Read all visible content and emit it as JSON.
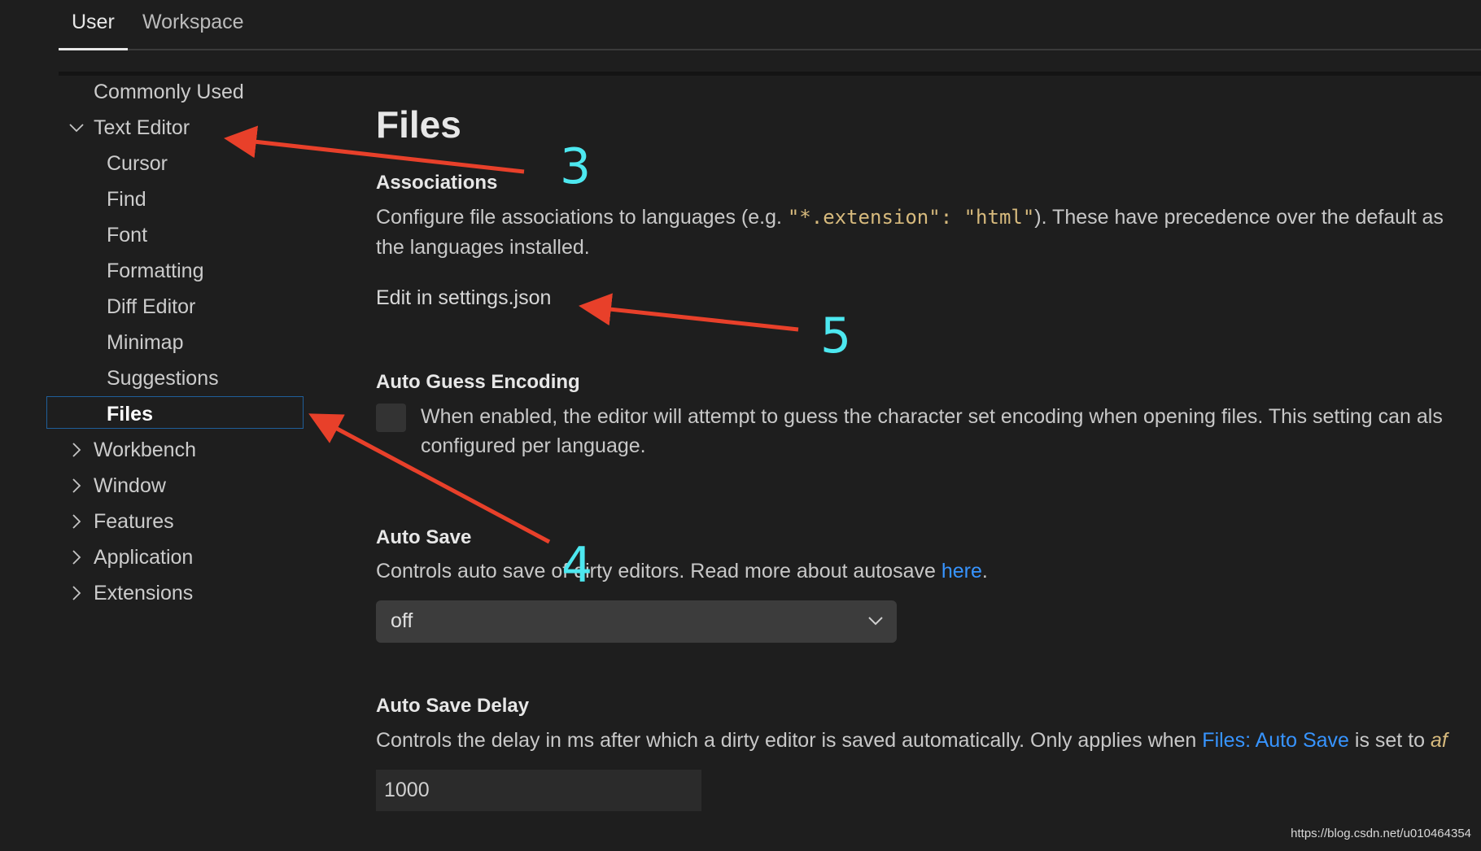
{
  "tabs": [
    {
      "label": "User",
      "active": true
    },
    {
      "label": "Workspace",
      "active": false
    }
  ],
  "sidebar": {
    "items": [
      {
        "label": "Commonly Used"
      },
      {
        "label": "Text Editor",
        "expanded": true,
        "icon": "chevron-down-icon"
      },
      {
        "label": "Cursor"
      },
      {
        "label": "Find"
      },
      {
        "label": "Font"
      },
      {
        "label": "Formatting"
      },
      {
        "label": "Diff Editor"
      },
      {
        "label": "Minimap"
      },
      {
        "label": "Suggestions"
      },
      {
        "label": "Files",
        "selected": true
      },
      {
        "label": "Workbench",
        "icon": "chevron-right-icon"
      },
      {
        "label": "Window",
        "icon": "chevron-right-icon"
      },
      {
        "label": "Features",
        "icon": "chevron-right-icon"
      },
      {
        "label": "Application",
        "icon": "chevron-right-icon"
      },
      {
        "label": "Extensions",
        "icon": "chevron-right-icon"
      }
    ]
  },
  "main": {
    "title": "Files",
    "associations": {
      "title": "Associations",
      "desc_pre": "Configure file associations to languages (e.g. ",
      "desc_code": "\"*.extension\": \"html\"",
      "desc_post": "). These have precedence over the default as",
      "desc_line2": "the languages installed.",
      "edit_link": "Edit in settings.json"
    },
    "auto_guess": {
      "title": "Auto Guess Encoding",
      "checked": false,
      "desc_line1": "When enabled, the editor will attempt to guess the character set encoding when opening files. This setting can als",
      "desc_line2": "configured per language."
    },
    "auto_save": {
      "title": "Auto Save",
      "desc_pre": "Controls auto save of dirty editors. Read more about autosave ",
      "desc_link": "here",
      "desc_post": ".",
      "value": "off"
    },
    "auto_save_delay": {
      "title": "Auto Save Delay",
      "desc_pre": "Controls the delay in ms after which a dirty editor is saved automatically. Only applies when ",
      "desc_link": "Files: Auto Save",
      "desc_mid": " is set to ",
      "desc_code": "af",
      "value": "1000"
    }
  },
  "annotations": [
    {
      "label": "3"
    },
    {
      "label": "5"
    },
    {
      "label": "4"
    }
  ],
  "watermark": "https://blog.csdn.net/u010464354",
  "colors": {
    "background": "#1e1e1e",
    "link": "#3794ff",
    "code": "#d7ba7d",
    "arrow": "#e8402a",
    "annotation_number": "#4de8f0",
    "selection_border": "#1f5e99"
  }
}
